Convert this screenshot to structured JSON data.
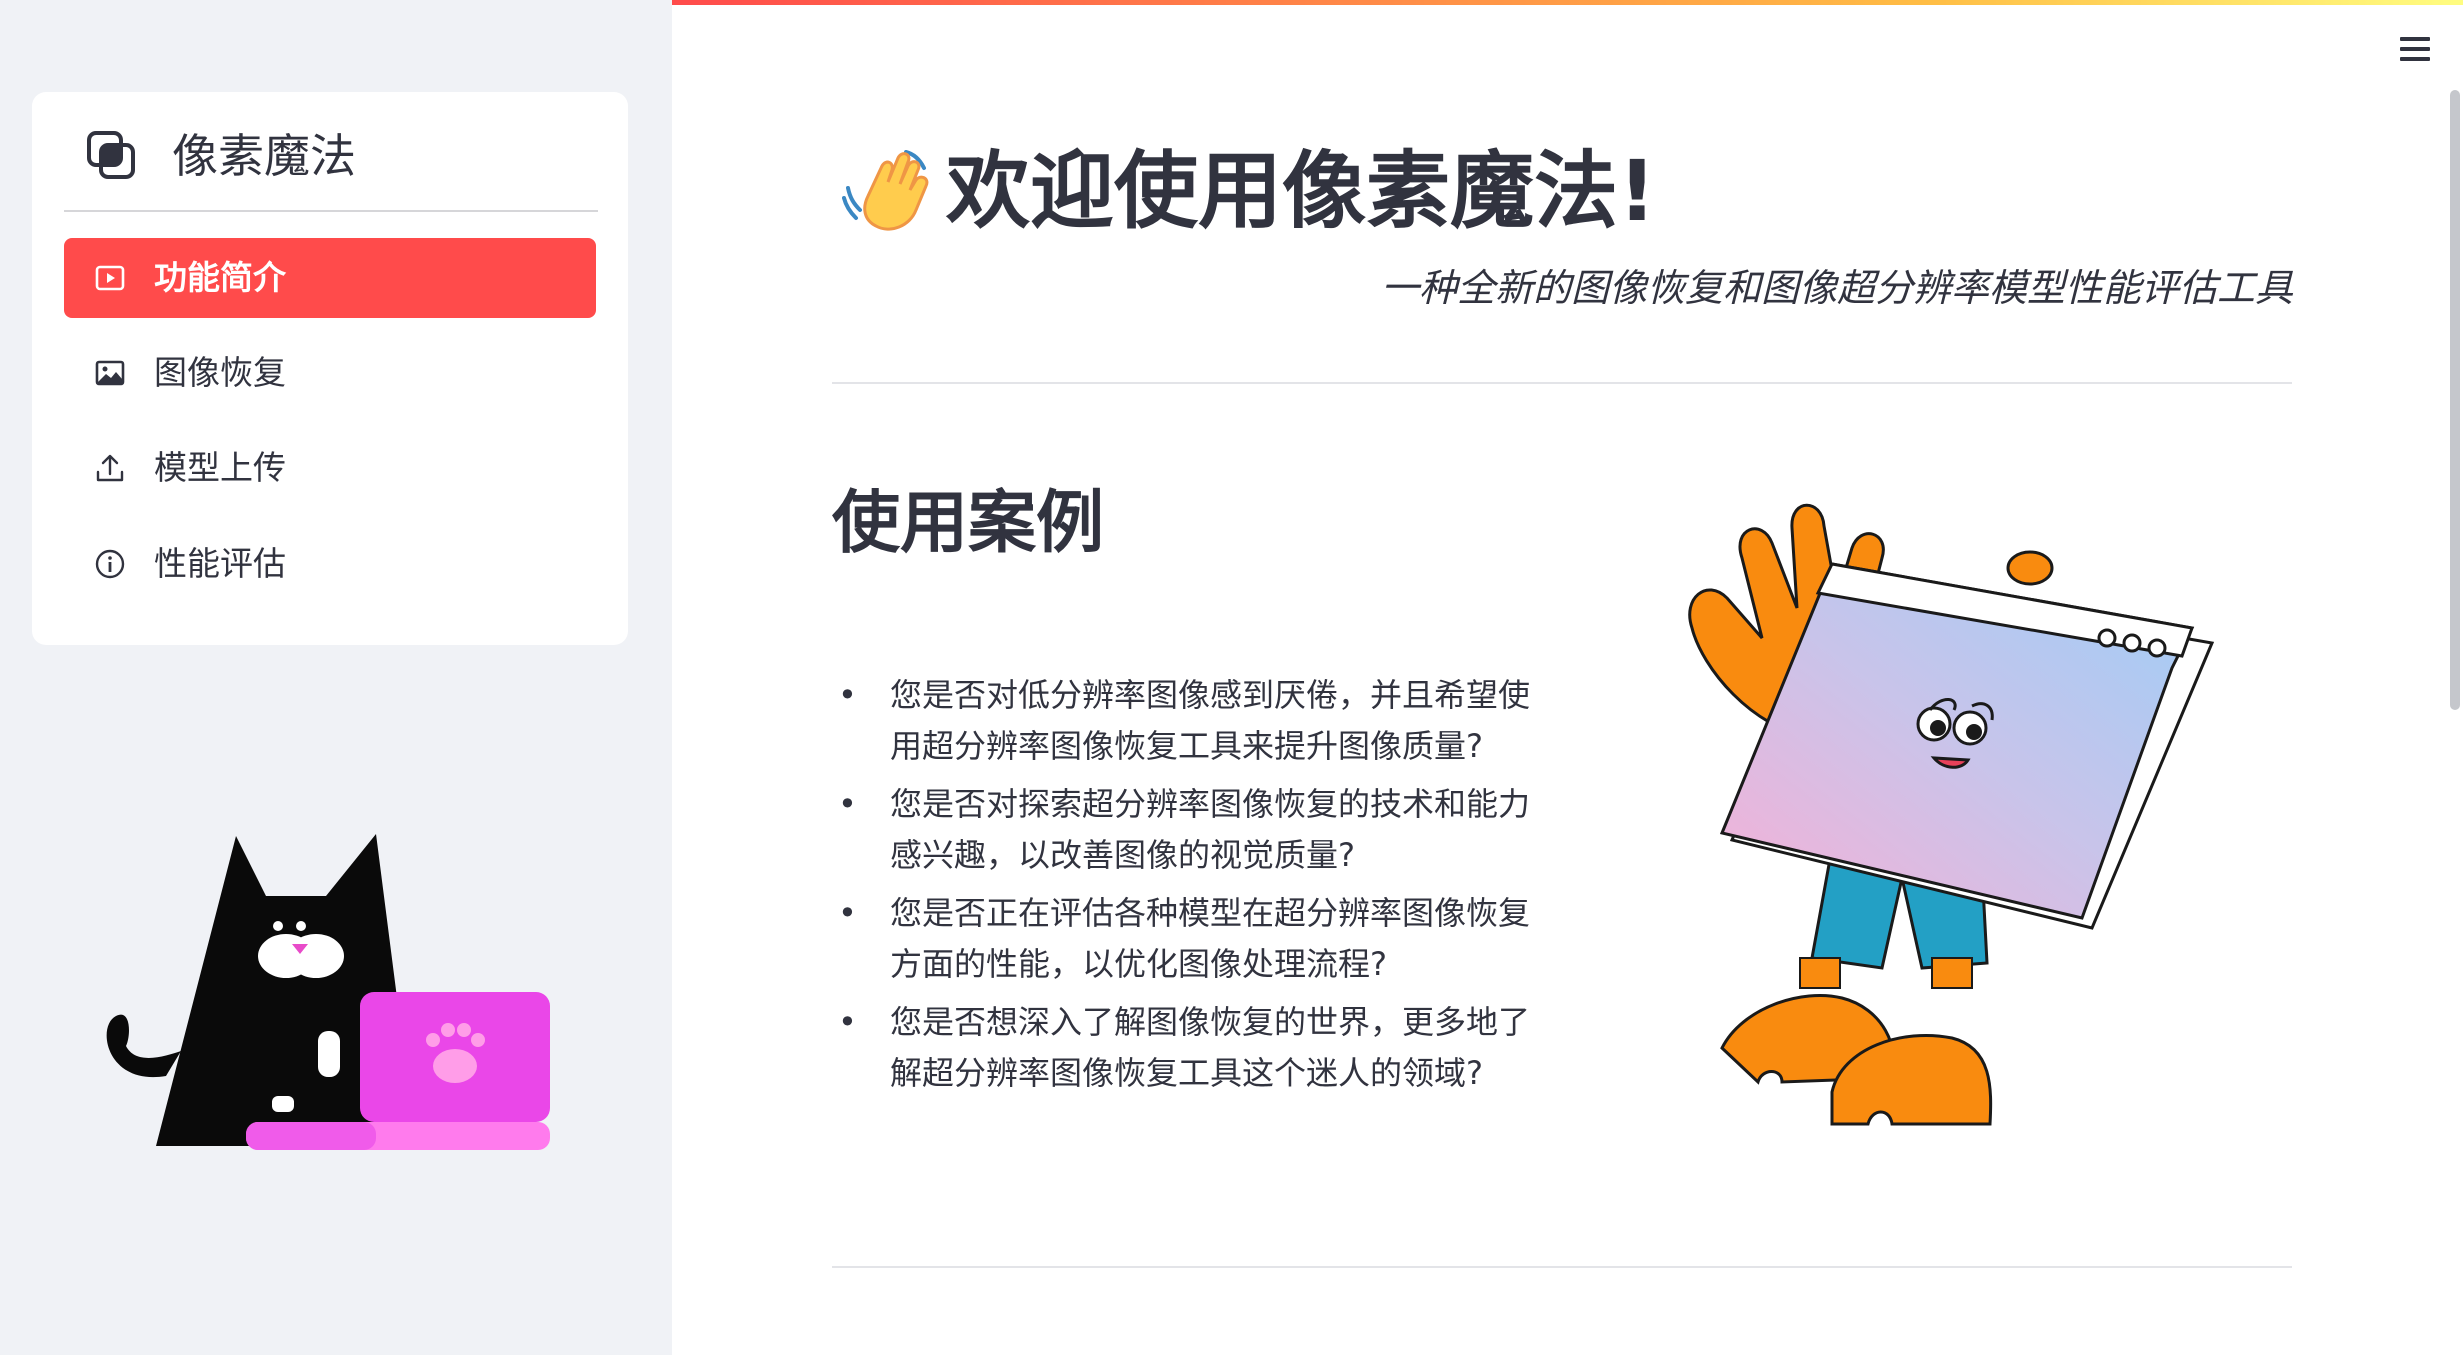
{
  "app": {
    "name": "像素魔法"
  },
  "sidebar": {
    "items": [
      {
        "label": "功能简介",
        "icon": "play-square-icon",
        "active": true
      },
      {
        "label": "图像恢复",
        "icon": "image-icon",
        "active": false
      },
      {
        "label": "模型上传",
        "icon": "upload-icon",
        "active": false
      },
      {
        "label": "性能评估",
        "icon": "info-circle-icon",
        "active": false
      }
    ],
    "active_color": "#ff4b4b"
  },
  "header": {
    "menu_icon": "hamburger-icon"
  },
  "main": {
    "title": "欢迎使用像素魔法!",
    "title_emoji": "waving-hand-icon",
    "subtitle": "一种全新的图像恢复和图像超分辨率模型性能评估工具",
    "section_title": "使用案例",
    "cases": [
      "您是否对低分辨率图像感到厌倦，并且希望使用超分辨率图像恢复工具来提升图像质量?",
      "您是否对探索超分辨率图像恢复的技术和能力感兴趣，以改善图像的视觉质量?",
      "您是否正在评估各种模型在超分辨率图像恢复方面的性能，以优化图像处理流程?",
      "您是否想深入了解图像恢复的世界，更多地了解超分辨率图像恢复工具这个迷人的领域?"
    ]
  },
  "colors": {
    "sidebar_bg": "#f0f2f6",
    "text": "#31333f",
    "accent": "#ff4b4b"
  }
}
